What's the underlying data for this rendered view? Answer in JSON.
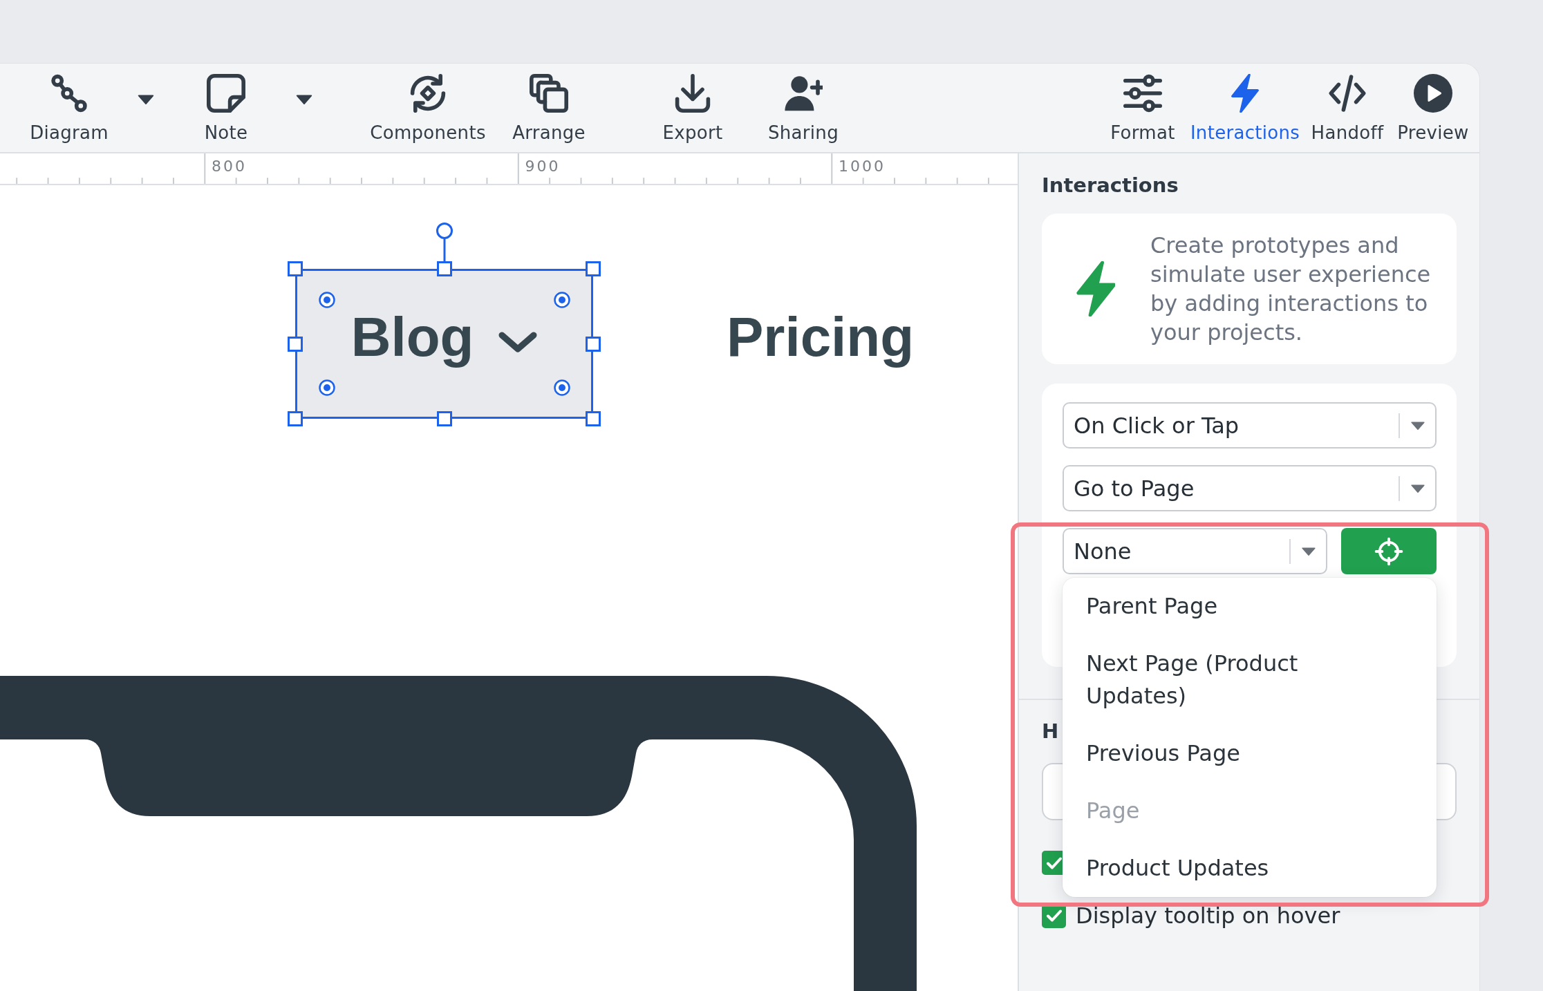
{
  "toolbar": {
    "left_items": [
      {
        "label": "Diagram",
        "selected": false,
        "dropdown": true
      },
      {
        "label": "Note",
        "selected": false,
        "dropdown": true
      },
      {
        "label": "Components",
        "selected": false,
        "dropdown": false
      },
      {
        "label": "Arrange",
        "selected": false,
        "dropdown": false
      },
      {
        "label": "Export",
        "selected": false,
        "dropdown": false
      },
      {
        "label": "Sharing",
        "selected": false,
        "dropdown": false
      }
    ],
    "right_items": [
      {
        "label": "Format",
        "selected": false
      },
      {
        "label": "Interactions",
        "selected": true
      },
      {
        "label": "Handoff",
        "selected": false
      },
      {
        "label": "Preview",
        "selected": false
      }
    ]
  },
  "ruler": {
    "labels": [
      "800",
      "900",
      "1000"
    ]
  },
  "canvas": {
    "elements": [
      {
        "label": "Blog",
        "dropdown": true,
        "selected": true
      },
      {
        "label": "Pricing",
        "dropdown": false,
        "selected": false
      }
    ]
  },
  "panel": {
    "title": "Interactions",
    "intro": "Create prototypes and simulate user experience by adding interactions to your projects.",
    "trigger": "On Click or Tap",
    "action": "Go to Page",
    "target": {
      "value": "None",
      "open": true,
      "highlighted": true
    },
    "target_options": [
      {
        "label": "Parent Page",
        "kind": "option"
      },
      {
        "label": "Next Page (Product Updates)",
        "kind": "option"
      },
      {
        "label": "Previous Page",
        "kind": "option"
      },
      {
        "label": "Page",
        "kind": "group"
      },
      {
        "label": "Product Updates",
        "kind": "option"
      }
    ],
    "section_heading": "H",
    "checkboxes": [
      {
        "checked": true
      },
      {
        "label": "Display tooltip on hover",
        "checked": true
      }
    ]
  }
}
